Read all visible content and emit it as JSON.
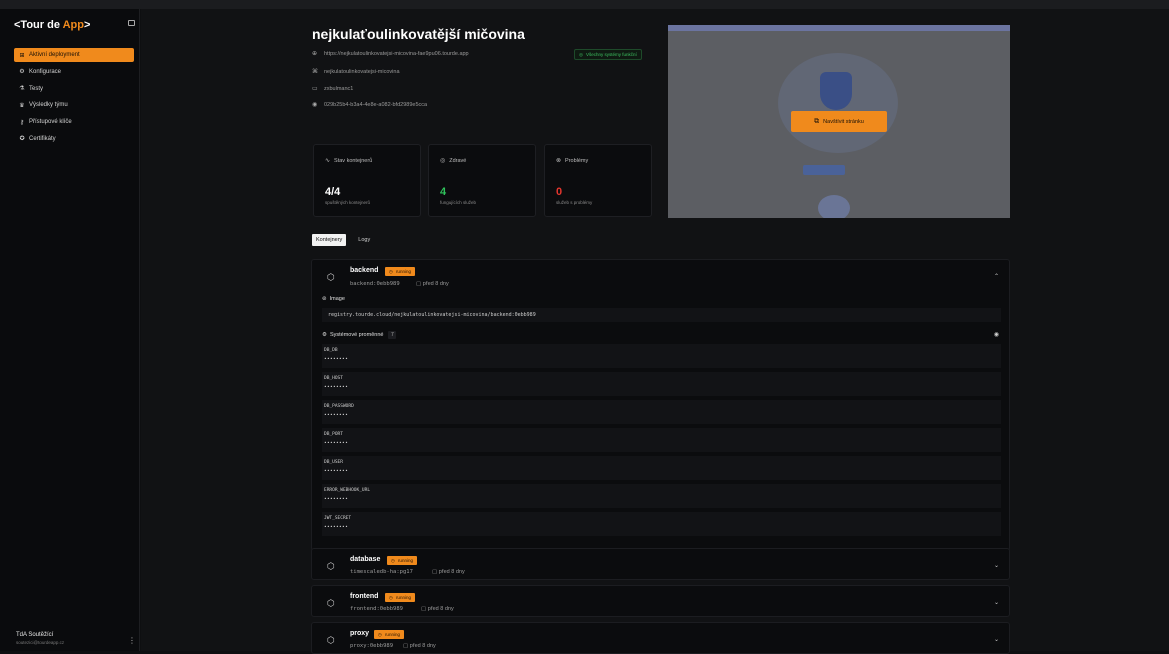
{
  "app": {
    "logo_open": "<Tour de ",
    "logo_accent": "App",
    "logo_close": ">"
  },
  "sidebar": {
    "items": [
      {
        "icon": "⊞",
        "label": "Aktivní deployment",
        "active": true
      },
      {
        "icon": "⚙",
        "label": "Konfigurace"
      },
      {
        "icon": "⚗",
        "label": "Testy"
      },
      {
        "icon": "♛",
        "label": "Výsledky týmu"
      },
      {
        "icon": "⚷",
        "label": "Přístupové klíče"
      },
      {
        "icon": "✪",
        "label": "Certifikáty"
      }
    ],
    "user_name": "TdA Soutěžící",
    "user_email": "soutezici@tourdeapp.cz"
  },
  "deployment": {
    "title": "nejkulaťoulinkovatější mičovina",
    "url": "https://nejkulatoulinkovatejsi-micovina-fae9pu06.tourde.app",
    "name": "nejkulatoulinkovatejsi-micovina",
    "user": "zxbulmanc1",
    "id": "029b25b4-b3a4-4e8e-a082-bfd2989e5cca",
    "status_text": "Všechny systémy funkční"
  },
  "stats": [
    {
      "label": "Stav kontejnerů",
      "icon": "∿",
      "value": "4/4",
      "sub": "spuštěných kontejnerů",
      "color": "#ffffff"
    },
    {
      "label": "Zdravé",
      "icon": "◎",
      "value": "4",
      "sub": "fungujících služeb",
      "color": "#2fc25b"
    },
    {
      "label": "Problémy",
      "icon": "⊗",
      "value": "0",
      "sub": "služeb s problémy",
      "color": "#e5362e"
    }
  ],
  "preview": {
    "visit_label": "Navštívit stránku"
  },
  "tabs": [
    {
      "label": "Kontejnery",
      "active": true
    },
    {
      "label": "Logy",
      "active": false
    }
  ],
  "containers": {
    "backend": {
      "name": "backend",
      "status": "running",
      "tag": "backend:0ebb989",
      "age": "před 8 dny",
      "image_label": "Image",
      "image": "registry.tourde.cloud/nejkulatoulinkovatejsi-micovina/backend:0ebb989",
      "env_label": "Systémové proměnné",
      "env_count": "7",
      "env": [
        {
          "name": "DB_DB",
          "value": "••••••••"
        },
        {
          "name": "DB_HOST",
          "value": "••••••••"
        },
        {
          "name": "DB_PASSWORD",
          "value": "••••••••"
        },
        {
          "name": "DB_PORT",
          "value": "••••••••"
        },
        {
          "name": "DB_USER",
          "value": "••••••••"
        },
        {
          "name": "ERROR_WEBHOOK_URL",
          "value": "••••••••"
        },
        {
          "name": "JWT_SECRET",
          "value": "••••••••"
        }
      ]
    },
    "others": [
      {
        "name": "database",
        "status": "running",
        "tag": "timescaledb-ha:pg17",
        "age": "před 8 dny"
      },
      {
        "name": "frontend",
        "status": "running",
        "tag": "frontend:0ebb989",
        "age": "před 8 dny"
      },
      {
        "name": "proxy",
        "status": "running",
        "tag": "proxy:0ebb989",
        "age": "před 8 dny"
      }
    ]
  },
  "icons": {
    "globe": "globe-icon",
    "github": "github-icon",
    "user": "user-card-icon",
    "discord": "discord-icon",
    "cube": "cube-icon",
    "chevron_up": "chevron-up-icon",
    "chevron_down": "chevron-down-icon",
    "eye": "eye-icon",
    "external_link": "external-link-icon"
  },
  "colors": {
    "accent": "#f08a1c",
    "ok": "#2fc25b",
    "error": "#e5362e"
  }
}
